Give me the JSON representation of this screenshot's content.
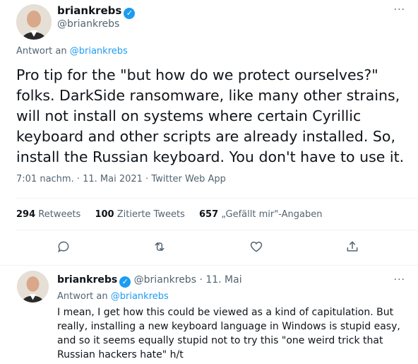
{
  "tweet": {
    "author_name": "briankrebs",
    "author_handle": "@briankrebs",
    "replying_to_prefix": "Antwort an",
    "replying_to": "@briankrebs",
    "text": "Pro tip for the \"but how do we protect ourselves?\" folks. DarkSide ransomware, like many other strains, will not install on systems where certain Cyrillic keyboard and other scripts are already installed. So, install the Russian keyboard. You don't have to use it.",
    "meta": "7:01 nachm. · 11. Mai 2021 · Twitter Web App",
    "stats": {
      "retweets_count": "294",
      "retweets_label": "Retweets",
      "quotes_count": "100",
      "quotes_label": "Zitierte Tweets",
      "likes_count": "657",
      "likes_label": "„Gefällt mir\"-Angaben"
    },
    "more_icon": "more-icon",
    "verified_icon": "verified-badge-icon"
  },
  "actions": [
    "reply-icon",
    "retweet-icon",
    "like-icon",
    "share-icon"
  ],
  "reply": {
    "author_name": "briankrebs",
    "handle_date": "@briankrebs · 11. Mai",
    "replying_to_prefix": "Antwort an",
    "replying_to": "@briankrebs",
    "text": "I mean, I get how this could be viewed as a kind of capitulation. But really, installing a new keyboard language in Windows is stupid easy, and so it seems equally stupid not to try this \"one weird trick that Russian hackers hate\" h/t"
  },
  "colors": {
    "accent": "#1d9bf0",
    "text": "#0f1419",
    "secondary": "#536471",
    "border": "#eff3f4"
  }
}
